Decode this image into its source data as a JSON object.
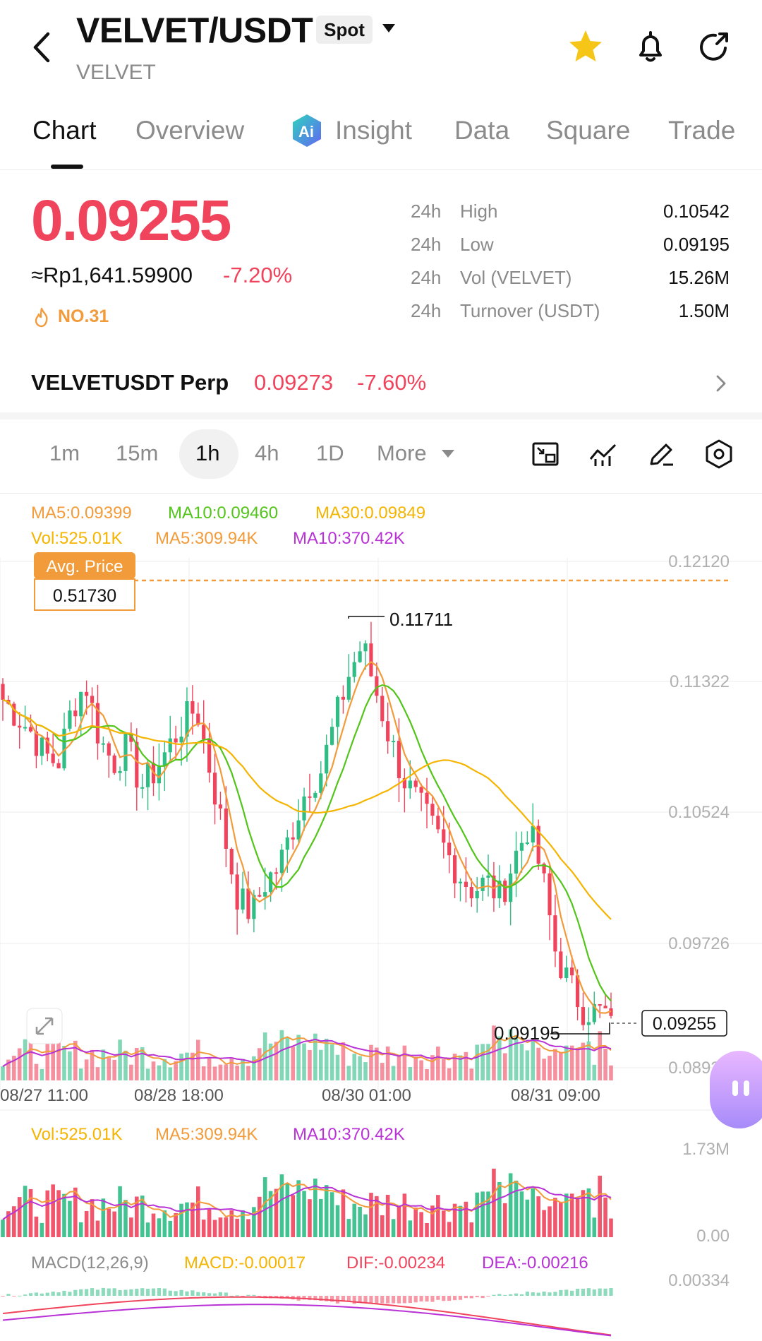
{
  "header": {
    "pair": "VELVET/USDT",
    "market_type": "Spot",
    "base_asset": "VELVET"
  },
  "tabs": [
    {
      "label": "Chart",
      "active": true
    },
    {
      "label": "Overview"
    },
    {
      "label": "Insight"
    },
    {
      "label": "Data"
    },
    {
      "label": "Square"
    },
    {
      "label": "Trade"
    }
  ],
  "ticker": {
    "last_price": "0.09255",
    "fiat_price": "≈Rp1,641.59900",
    "change": "-7.20%",
    "rank": "NO.31",
    "stats": [
      {
        "period": "24h",
        "label": "High",
        "value": "0.10542"
      },
      {
        "period": "24h",
        "label": "Low",
        "value": "0.09195"
      },
      {
        "period": "24h",
        "label": "Vol (VELVET)",
        "value": "15.26M"
      },
      {
        "period": "24h",
        "label": "Turnover (USDT)",
        "value": "1.50M"
      }
    ]
  },
  "perp": {
    "name": "VELVETUSDT Perp",
    "price": "0.09273",
    "change": "-7.60%"
  },
  "intervals": [
    "1m",
    "15m",
    "1h",
    "4h",
    "1D",
    "More"
  ],
  "selected_interval": "1h",
  "colors": {
    "up": "#2fbd85",
    "down": "#f0445d",
    "ma5": "#f29b3a",
    "ma10": "#52c41a",
    "ma30": "#f5b400",
    "vol_ma10": "#b832d6"
  },
  "chart_data": {
    "type": "candlestick",
    "price_legend": [
      {
        "label": "MA5:0.09399",
        "color": "#f29b3a"
      },
      {
        "label": "MA10:0.09460",
        "color": "#52c41a"
      },
      {
        "label": "MA30:0.09849",
        "color": "#f5b400"
      }
    ],
    "vol_legend": [
      {
        "label": "Vol:525.01K",
        "color": "#f5b400"
      },
      {
        "label": "MA5:309.94K",
        "color": "#f29b3a"
      },
      {
        "label": "MA10:370.42K",
        "color": "#b832d6"
      }
    ],
    "avg_price_label": "Avg. Price",
    "avg_price_value": "0.51730",
    "y_ticks": [
      "0.12120",
      "0.11322",
      "0.10524",
      "0.09726",
      "0.08929"
    ],
    "y_range": [
      0.08929,
      0.1212
    ],
    "x_ticks": [
      "08/27 11:00",
      "08/28 18:00",
      "08/30 01:00",
      "08/31 09:00"
    ],
    "high_marker": "0.11711",
    "low_marker": "0.09195",
    "last_price_marker": "0.09255",
    "close_path": [
      0.1125,
      0.1115,
      0.1105,
      0.109,
      0.1085,
      0.112,
      0.1135,
      0.11,
      0.1085,
      0.1095,
      0.107,
      0.108,
      0.1095,
      0.111,
      0.112,
      0.108,
      0.104,
      0.1,
      0.099,
      0.101,
      0.102,
      0.1045,
      0.107,
      0.108,
      0.111,
      0.114,
      0.116,
      0.113,
      0.11,
      0.1075,
      0.106,
      0.1045,
      0.103,
      0.1015,
      0.1005,
      0.101,
      0.1,
      0.1025,
      0.1045,
      0.1015,
      0.0965,
      0.0945,
      0.093,
      0.0928,
      0.0926
    ],
    "volume_panel": {
      "legend": [
        {
          "label": "Vol:525.01K",
          "color": "#f5b400"
        },
        {
          "label": "MA5:309.94K",
          "color": "#f29b3a"
        },
        {
          "label": "MA10:370.42K",
          "color": "#b832d6"
        }
      ],
      "y_ticks": [
        "1.73M",
        "0.00"
      ]
    },
    "macd_panel": {
      "legend": [
        {
          "label": "MACD(12,26,9)",
          "color": "#8a8a8a"
        },
        {
          "label": "MACD:-0.00017",
          "color": "#f5b400"
        },
        {
          "label": "DIF:-0.00234",
          "color": "#f0445d"
        },
        {
          "label": "DEA:-0.00216",
          "color": "#b832d6"
        }
      ],
      "y_ticks": [
        "0.00334"
      ]
    }
  }
}
